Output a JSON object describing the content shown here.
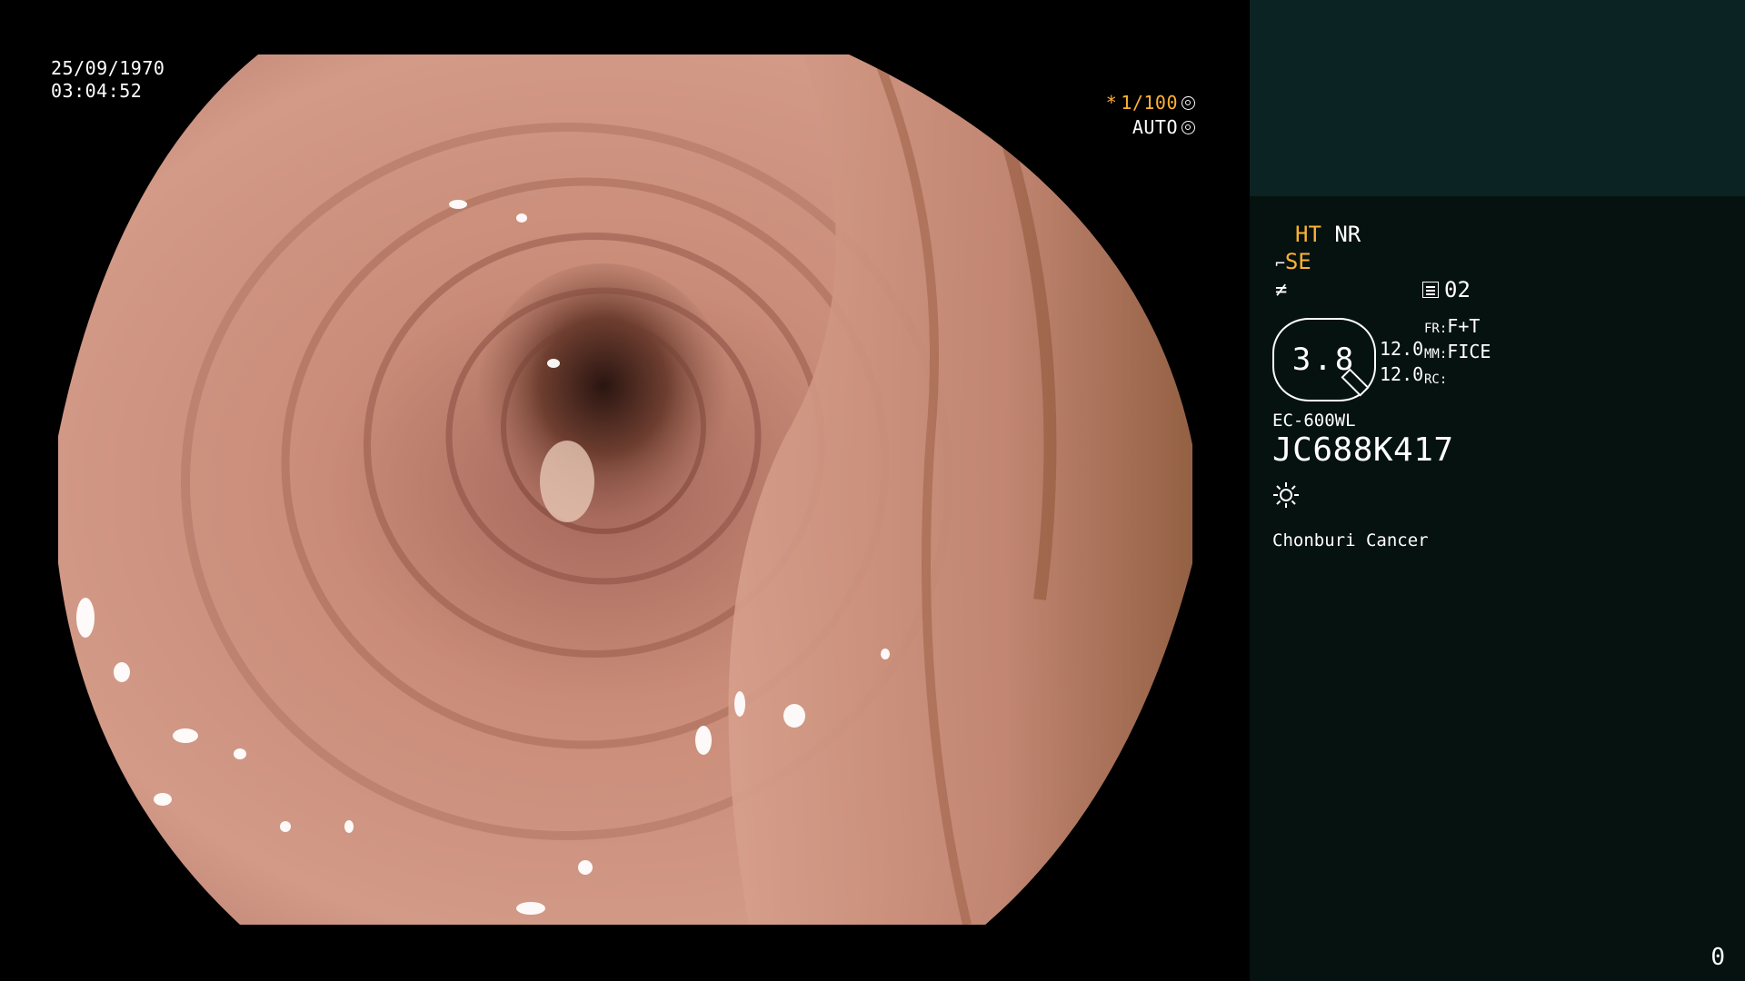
{
  "overlay": {
    "date": "25/09/1970",
    "time": "03:04:52",
    "shutter_star": "*",
    "shutter_value": "1/100",
    "exposure_mode": "AUTO",
    "shutter_icon": "aperture-icon",
    "exposure_icon": "target-circle-icon"
  },
  "panel": {
    "modes": {
      "ht": "HT",
      "nr": "NR",
      "se": "SE",
      "se_icon": "scope-hook-icon",
      "fx_icon": "not-equal-icon"
    },
    "image_count_icon": "list-box-icon",
    "image_count": "02",
    "zoom": {
      "value": "3.8",
      "range_top": "12.0",
      "range_bottom": "12.0"
    },
    "settings": {
      "fr_label": "FR:",
      "fr_value": "F+T",
      "mm_label": "MM:",
      "mm_value": "FICE",
      "rc_label": "RC:",
      "rc_value": ""
    },
    "scope_model": "EC-600WL",
    "scope_serial": "JC688K417",
    "light_icon": "sun-icon",
    "institution": "Chonburi Cancer",
    "counter": "0"
  },
  "colors": {
    "panel_bg": "#06120f",
    "panel_top": "#0b2323",
    "accent": "#ffb234",
    "tissue": "#c98c78"
  }
}
